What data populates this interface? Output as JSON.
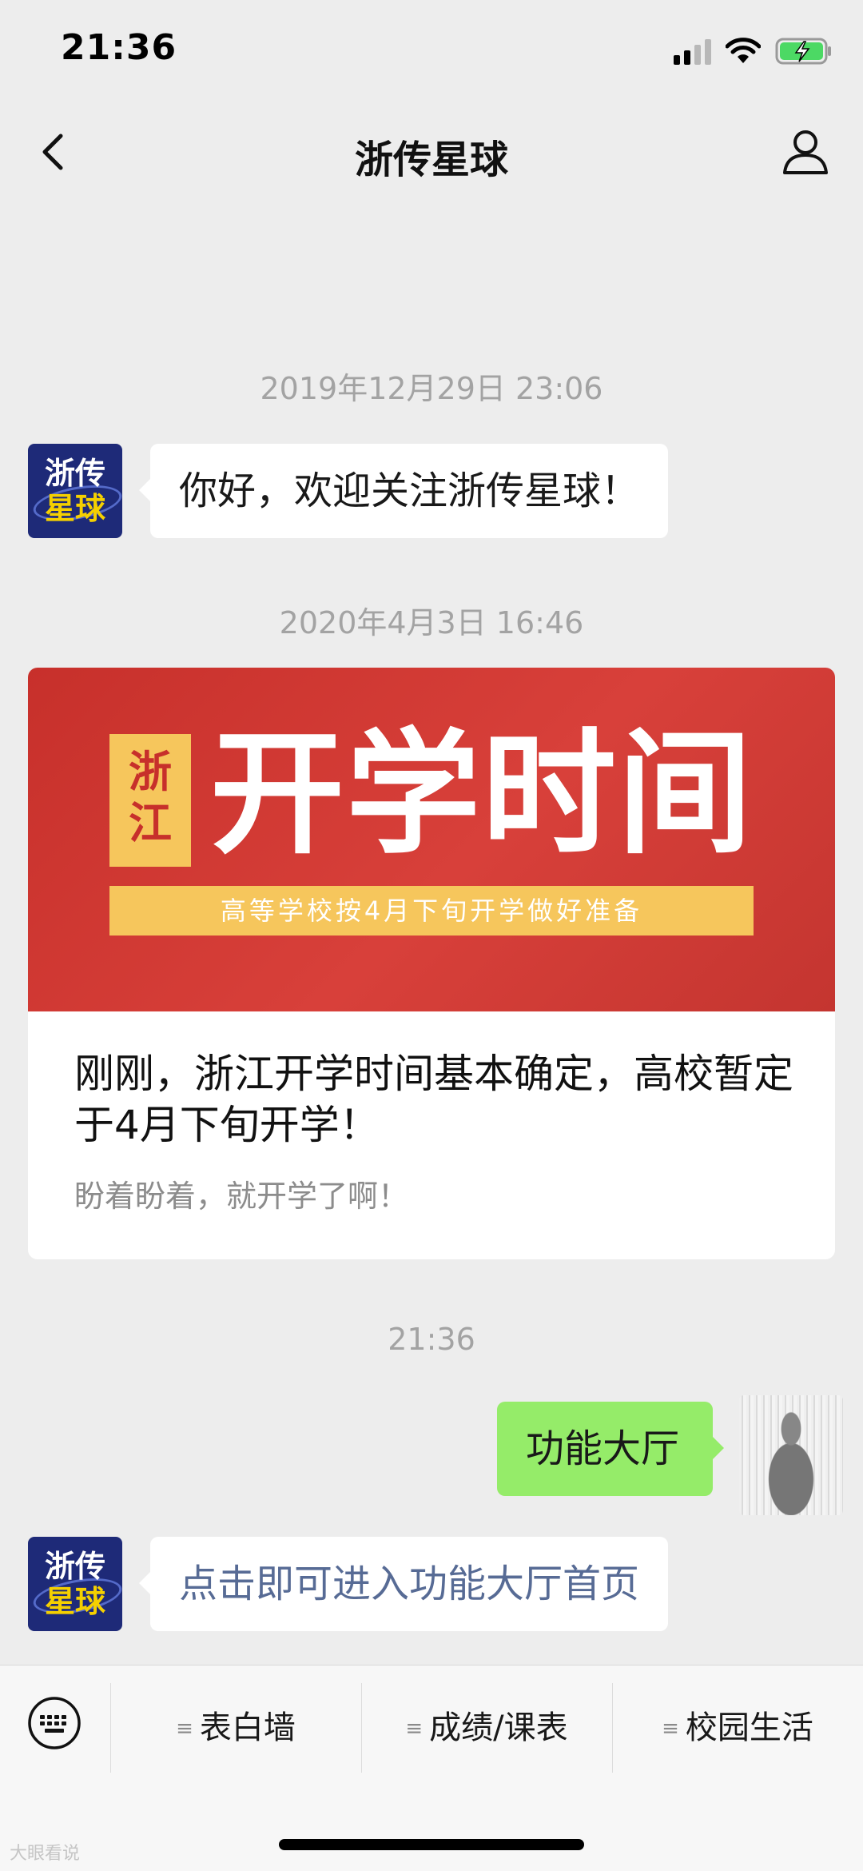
{
  "status_bar": {
    "time": "21:36"
  },
  "nav": {
    "title": "浙传星球",
    "back_icon": "chevron-left-icon",
    "profile_icon": "person-icon"
  },
  "official_avatar": {
    "line1": "浙传",
    "line2": "星球"
  },
  "messages": {
    "ts1": "2019年12月29日 23:06",
    "welcome": "你好，欢迎关注浙传星球！",
    "ts2": "2020年4月3日 16:46",
    "ts3": "21:36",
    "my_message": "功能大厅",
    "reply_link": "点击即可进入功能大厅首页"
  },
  "article": {
    "cover_badge": "浙江",
    "cover_title": "开学时间",
    "cover_strip": "高等学校按4月下旬开学做好准备",
    "title": "刚刚，浙江开学时间基本确定，高校暂定于4月下旬开学！",
    "digest": "盼着盼着，就开学了啊！"
  },
  "menu": {
    "glyph": "≡",
    "items": [
      {
        "label": "表白墙"
      },
      {
        "label": "成绩/课表"
      },
      {
        "label": "校园生活"
      }
    ]
  },
  "watermark": "大眼看说",
  "colors": {
    "background": "#ededed",
    "my_bubble": "#95ec69",
    "link": "#576b95",
    "cover_red": "#c7302b",
    "cover_yellow": "#f6c65c"
  }
}
